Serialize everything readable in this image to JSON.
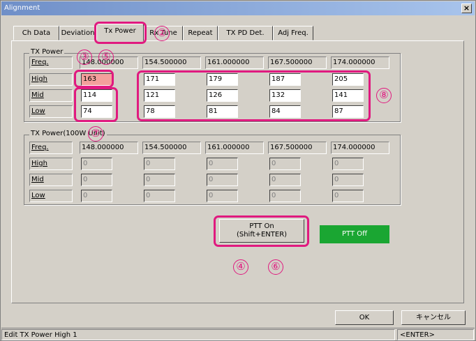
{
  "window": {
    "title": "Alignment",
    "close_symbol": "×"
  },
  "tabs": [
    "Ch Data",
    "Deviation",
    "Tx Power",
    "Rx Tune",
    "Repeat",
    "TX PD Det.",
    "Adj Freq."
  ],
  "active_tab": "Tx Power",
  "tx_power": {
    "title": "TX Power",
    "freq_label": "Freq.",
    "freqs": [
      "148.000000",
      "154.500000",
      "161.000000",
      "167.500000",
      "174.000000"
    ],
    "rows": [
      {
        "label": "High",
        "values": [
          "163",
          "171",
          "179",
          "187",
          "205"
        ]
      },
      {
        "label": "Mid",
        "values": [
          "114",
          "121",
          "126",
          "132",
          "141"
        ]
      },
      {
        "label": "Low",
        "values": [
          "74",
          "78",
          "81",
          "84",
          "87"
        ]
      }
    ],
    "selected_value": "163"
  },
  "tx_power_100w": {
    "title": "TX Power(100W Unit)",
    "freq_label": "Freq.",
    "freqs": [
      "148.000000",
      "154.500000",
      "161.000000",
      "167.500000",
      "174.000000"
    ],
    "rows": [
      {
        "label": "High",
        "values": [
          "0",
          "0",
          "0",
          "0",
          "0"
        ]
      },
      {
        "label": "Mid",
        "values": [
          "0",
          "0",
          "0",
          "0",
          "0"
        ]
      },
      {
        "label": "Low",
        "values": [
          "0",
          "0",
          "0",
          "0",
          "0"
        ]
      }
    ]
  },
  "ptt": {
    "button_line1": "PTT On",
    "button_line2": "(Shift+ENTER)",
    "status": "PTT Off",
    "status_color": "#1aa632"
  },
  "buttons": {
    "ok": "OK",
    "cancel": "キャンセル"
  },
  "statusbar": {
    "message": "Edit TX Power High 1",
    "key_hint": "<ENTER>"
  },
  "annotations": {
    "color": "#e0197f",
    "numbers": [
      "②",
      "③",
      "⑤",
      "⑦",
      "⑧",
      "④",
      "⑥"
    ]
  }
}
